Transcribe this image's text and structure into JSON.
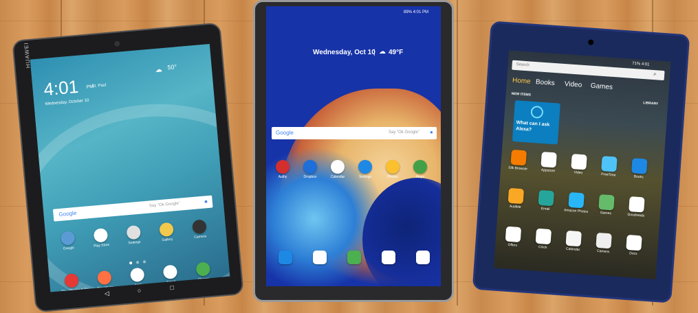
{
  "huawei": {
    "brand": "HUAWEI",
    "time": "4:01",
    "ampm": "PM",
    "city": "St. Paul",
    "temp": "50°",
    "date": "Wednesday, October 10",
    "search_brand": "Google",
    "search_hint": "Say \"Ok Google\"",
    "apps": [
      {
        "label": "Google",
        "color": "#5b9bd5"
      },
      {
        "label": "Play Store",
        "color": "#ffffff"
      },
      {
        "label": "Settings",
        "color": "#e0e0e0"
      },
      {
        "label": "Gallery",
        "color": "#f2c94c"
      },
      {
        "label": "Camera",
        "color": "#333333"
      }
    ],
    "dock": [
      {
        "label": "Play Movies & TV",
        "color": "#e53935"
      },
      {
        "label": "Play Music",
        "color": "#ff7043"
      },
      {
        "label": "Apps",
        "color": "#ffffff"
      },
      {
        "label": "Email",
        "color": "#ffffff"
      },
      {
        "label": "Chrome",
        "color": "#4caf50"
      }
    ]
  },
  "samsung": {
    "status": "89% 4:01 PM",
    "date_weather": "Wednesday, Oct 10",
    "temp": "49°F",
    "search_brand": "Google",
    "search_hint": "Say \"Ok Google\"",
    "apps": [
      {
        "label": "Authy",
        "color": "#d32f2f"
      },
      {
        "label": "Dropbox",
        "color": "#1e6fd9"
      },
      {
        "label": "Calendar",
        "color": "#ffffff"
      },
      {
        "label": "Settings",
        "color": "#1e88e5"
      },
      {
        "label": "Photos",
        "color": "#fbc02d"
      },
      {
        "label": "Maps",
        "color": "#43a047"
      }
    ],
    "dock_colors": [
      "#1e88e5",
      "#ffffff",
      "#4caf50",
      "#ffffff",
      "#ffffff"
    ]
  },
  "fire": {
    "status": "71% 4:01",
    "search_placeholder": "Search",
    "tabs": [
      "Home",
      "Books",
      "Video",
      "Games"
    ],
    "new_items": "NEW ITEMS",
    "library": "LIBRARY",
    "alexa": "What can I ask Alexa?",
    "apps": [
      {
        "label": "Silk Browser",
        "color": "#f57c00"
      },
      {
        "label": "Appstore",
        "color": "#ffffff"
      },
      {
        "label": "Video",
        "color": "#ffffff"
      },
      {
        "label": "FreeTime",
        "color": "#4fc3f7"
      },
      {
        "label": "Books",
        "color": "#1e88e5"
      },
      {
        "label": "Audible",
        "color": "#f9a825"
      },
      {
        "label": "Email",
        "color": "#26a69a"
      },
      {
        "label": "Amazon Photos",
        "color": "#29b6f6"
      },
      {
        "label": "Games",
        "color": "#66bb6a"
      },
      {
        "label": "Goodreads",
        "color": "#ffffff"
      },
      {
        "label": "Offers",
        "color": "#ffffff"
      },
      {
        "label": "Clock",
        "color": "#ffffff"
      },
      {
        "label": "Calendar",
        "color": "#f5f5f5"
      },
      {
        "label": "Camera",
        "color": "#eeeeee"
      },
      {
        "label": "Docs",
        "color": "#ffffff"
      }
    ]
  }
}
